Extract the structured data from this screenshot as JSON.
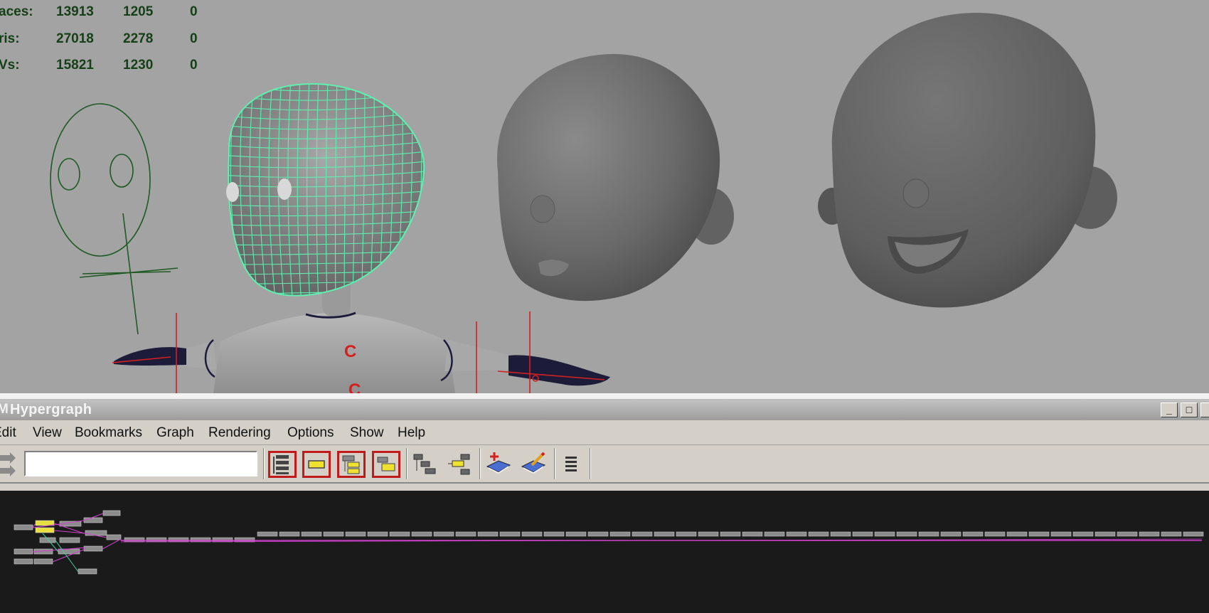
{
  "hud": {
    "rows": [
      {
        "label": "aces:",
        "a": "13913",
        "b": "1205",
        "c": "0"
      },
      {
        "label": "ris:",
        "a": "27018",
        "b": "2278",
        "c": "0"
      },
      {
        "label": "Vs:",
        "a": "15821",
        "b": "1230",
        "c": "0"
      }
    ]
  },
  "viewport": {
    "joint_labels": [
      "C",
      "C"
    ]
  },
  "hypergraph": {
    "title": "Hypergraph",
    "window_buttons": {
      "minimize": "_",
      "maximize": "□"
    },
    "menu": [
      "Edit",
      "View",
      "Bookmarks",
      "Graph",
      "Rendering",
      "Options",
      "Show",
      "Help"
    ],
    "search": {
      "value": "",
      "placeholder": ""
    },
    "toolbar_icons": [
      "scene-hierarchy-icon",
      "frame-selection-icon",
      "frame-hierarchy-icon",
      "frame-branch-icon",
      "horizontal-layout-icon",
      "vertical-layout-icon",
      "add-bookmark-icon",
      "edit-bookmark-icon",
      "options-menu-icon"
    ]
  },
  "colors": {
    "viewport_bg": "#a3a3a3",
    "hud_text": "#153f16",
    "wireframe": "#5ef0b0",
    "sketch_lines": "#1f5a24",
    "joint_red": "#d42020",
    "graph_bg": "#1a1a1a",
    "connection_magenta": "#d040d0"
  }
}
